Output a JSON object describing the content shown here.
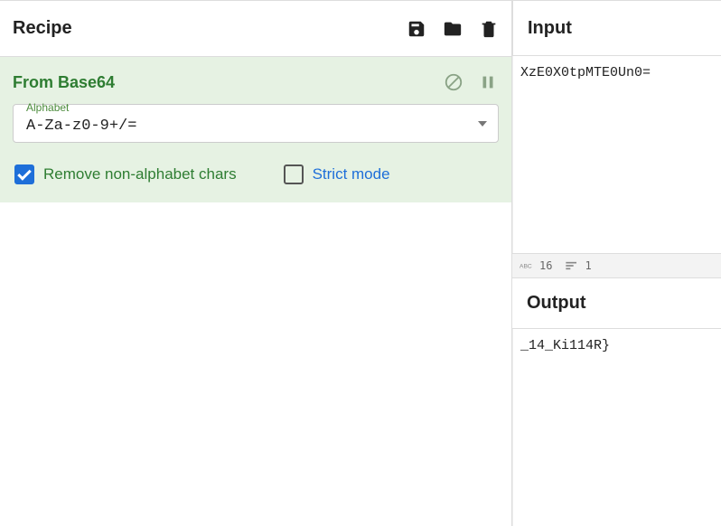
{
  "recipe": {
    "title": "Recipe",
    "icons": {
      "save": "save-icon",
      "open": "folder-icon",
      "delete": "trash-icon"
    },
    "operation": {
      "name": "From Base64",
      "alphabet_label": "Alphabet",
      "alphabet_value": "A-Za-z0-9+/=",
      "remove_nonalpha": {
        "checked": true,
        "label": "Remove non-alphabet chars"
      },
      "strict_mode": {
        "checked": false,
        "label": "Strict mode"
      }
    }
  },
  "input": {
    "title": "Input",
    "value": "XzE0X0tpMTE0Un0=",
    "stats": {
      "chars": "16",
      "lines": "1"
    }
  },
  "output": {
    "title": "Output",
    "value": "_14_Ki114R}"
  }
}
